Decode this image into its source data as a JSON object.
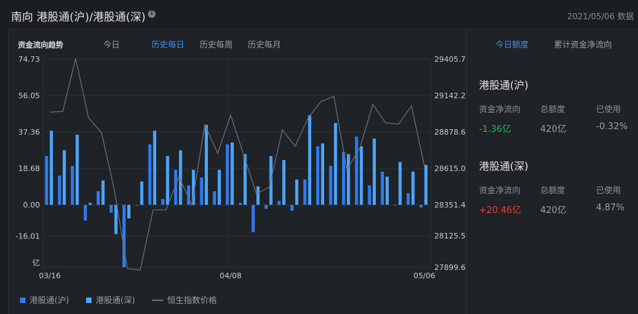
{
  "header": {
    "title": "南向 港股通(沪)/港股通(深)",
    "info_icon": "i",
    "date": "2021/05/06 数据"
  },
  "chart_tabs": {
    "section": "资金流向趋势",
    "items": [
      "今日",
      "历史每日",
      "历史每周",
      "历史每月"
    ],
    "active": 1
  },
  "right_tabs": {
    "items": [
      "今日额度",
      "累计资金净流向"
    ],
    "active": 0
  },
  "panels": [
    {
      "name": "港股通(沪)",
      "headers": [
        "资金净流向",
        "总额度",
        "已使用"
      ],
      "net": "-1.36亿",
      "quota": "420亿",
      "used": "-0.32%",
      "net_color": "#1fb85a"
    },
    {
      "name": "港股通(深)",
      "headers": [
        "资金净流向",
        "总额度",
        "已使用"
      ],
      "net": "+20.46亿",
      "quota": "420亿",
      "used": "4.87%",
      "net_color": "#f23b3b"
    }
  ],
  "colors": {
    "sh": "#2f7bf0",
    "sz": "#4ca6fb",
    "index": "#6c7178",
    "active": "#3e8ff0"
  },
  "chart_data": {
    "type": "bar",
    "left_ticks": [
      "74.73",
      "56.05",
      "37.36",
      "18.68",
      "0.00",
      "-16.01"
    ],
    "left_unit": "亿",
    "right_ticks": [
      "29405.7",
      "29142.2",
      "28878.6",
      "28615.0",
      "28351.4",
      "28125.5",
      "27899.6"
    ],
    "ylim": [
      -32.0,
      74.73
    ],
    "y2lim": [
      27899.6,
      29405.7
    ],
    "x_labels": [
      {
        "index": 0,
        "label": "03/16"
      },
      {
        "index": 14,
        "label": "04/08"
      },
      {
        "index": 29,
        "label": "05/06"
      }
    ],
    "legend": [
      "港股通(沪)",
      "港股通(深)",
      "恒生指数价格"
    ],
    "series": [
      {
        "name": "港股通(沪)",
        "values": [
          25,
          15,
          20,
          -8,
          7,
          -4,
          -32,
          -0.3,
          31,
          3,
          18,
          10,
          14,
          7,
          31,
          1,
          -14,
          -2,
          2,
          -3,
          13,
          30,
          20,
          27,
          35,
          10,
          17,
          -0.2,
          6,
          -1.36
        ]
      },
      {
        "name": "港股通(深)",
        "values": [
          38,
          28,
          36,
          1,
          12.5,
          -15,
          -7,
          12,
          38,
          25,
          28,
          18,
          41,
          18,
          32,
          26,
          9.5,
          25,
          23,
          13,
          46,
          31.5,
          42,
          26,
          30,
          34,
          14.5,
          22,
          17,
          20.46
        ]
      },
      {
        "name": "恒生指数价格",
        "values": [
          29022,
          29027,
          29410,
          28980,
          28873,
          28458,
          27890,
          27880,
          28315,
          28315,
          28555,
          28350,
          28930,
          28725,
          29000,
          28715,
          28430,
          28480,
          28894,
          28775,
          28980,
          29100,
          29135,
          28607,
          28760,
          29078,
          28945,
          28935,
          29068,
          28632
        ]
      }
    ]
  }
}
